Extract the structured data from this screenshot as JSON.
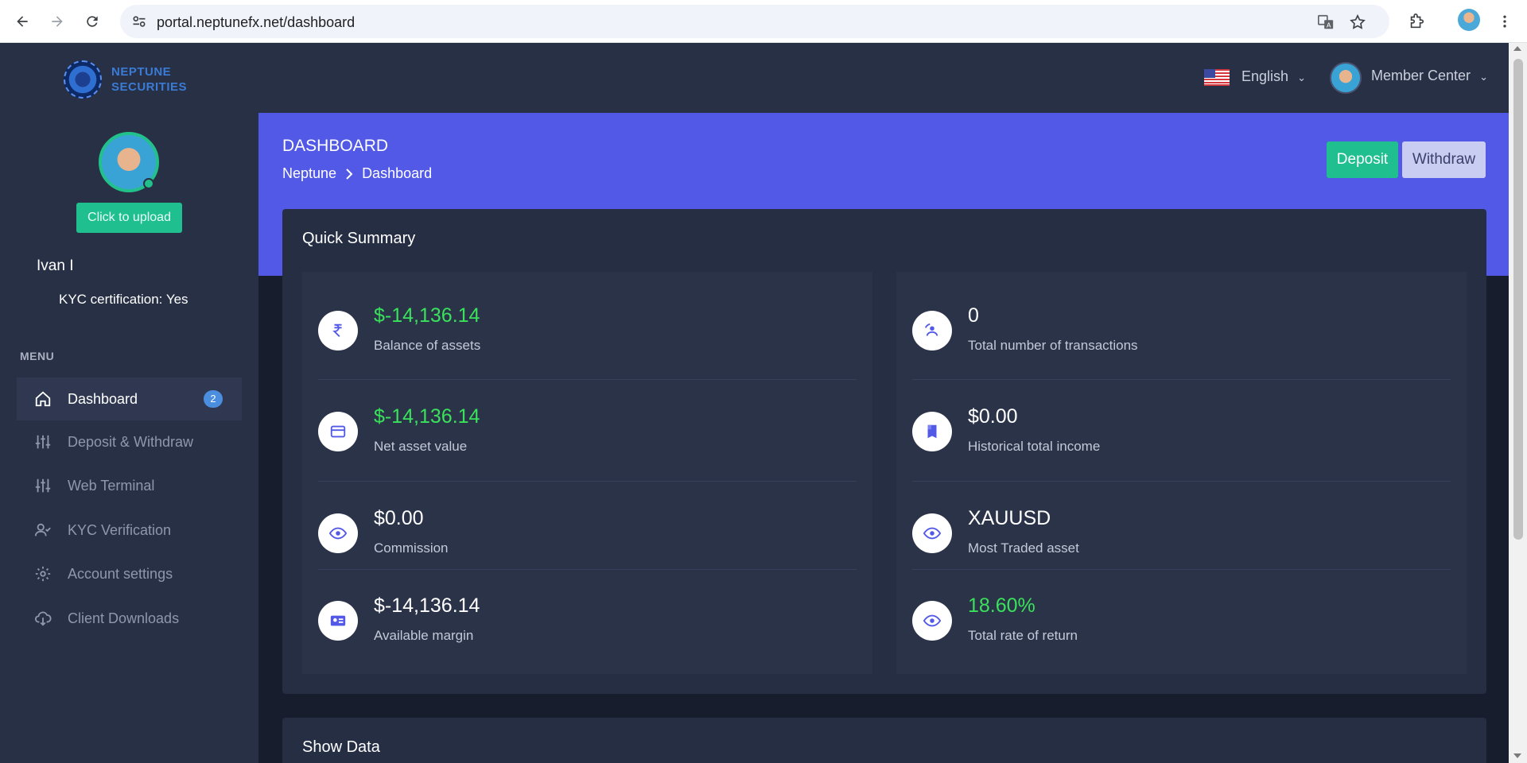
{
  "browser": {
    "url": "portal.neptunefx.net/dashboard"
  },
  "brand": {
    "line1": "NEPTUNE",
    "line2": "SECURITIES"
  },
  "profile": {
    "upload_label": "Click to upload",
    "name": "Ivan I",
    "kyc_label": "KYC certification:",
    "kyc_value": "Yes"
  },
  "menu": {
    "title": "MENU",
    "items": [
      {
        "label": "Dashboard",
        "icon": "home-icon",
        "badge": "2"
      },
      {
        "label": "Deposit & Withdraw",
        "icon": "sliders-icon"
      },
      {
        "label": "Web Terminal",
        "icon": "sliders-icon"
      },
      {
        "label": "KYC Verification",
        "icon": "user-check-icon"
      },
      {
        "label": "Account settings",
        "icon": "gear-icon"
      },
      {
        "label": "Client Downloads",
        "icon": "cloud-download-icon"
      }
    ]
  },
  "header": {
    "language": "English",
    "member_center": "Member Center"
  },
  "hero": {
    "title": "DASHBOARD",
    "breadcrumb_root": "Neptune",
    "breadcrumb_current": "Dashboard",
    "deposit_label": "Deposit",
    "withdraw_label": "Withdraw"
  },
  "summary": {
    "title": "Quick Summary",
    "left": [
      {
        "value": "$-14,136.14",
        "label": "Balance of assets",
        "icon": "rupee-icon",
        "highlight": true
      },
      {
        "value": "$-14,136.14",
        "label": "Net asset value",
        "icon": "credit-card-icon",
        "highlight": true
      },
      {
        "value": "$0.00",
        "label": "Commission",
        "icon": "eye-icon",
        "highlight": false
      },
      {
        "value": "$-14,136.14",
        "label": "Available margin",
        "icon": "wallet-user-icon",
        "highlight": false
      }
    ],
    "right": [
      {
        "value": "0",
        "label": "Total number of transactions",
        "icon": "transaction-icon",
        "highlight": false
      },
      {
        "value": "$0.00",
        "label": "Historical total income",
        "icon": "book-icon",
        "highlight": false
      },
      {
        "value": "XAUUSD",
        "label": "Most Traded asset",
        "icon": "eye-icon",
        "highlight": false
      },
      {
        "value": "18.60%",
        "label": "Total rate of return",
        "icon": "eye-icon",
        "highlight": true
      }
    ]
  },
  "show_data": {
    "title": "Show Data"
  },
  "colors": {
    "accent": "#5159e6",
    "success": "#1fbf8f",
    "positive_value": "#39e25a",
    "sidebar": "#283046"
  }
}
